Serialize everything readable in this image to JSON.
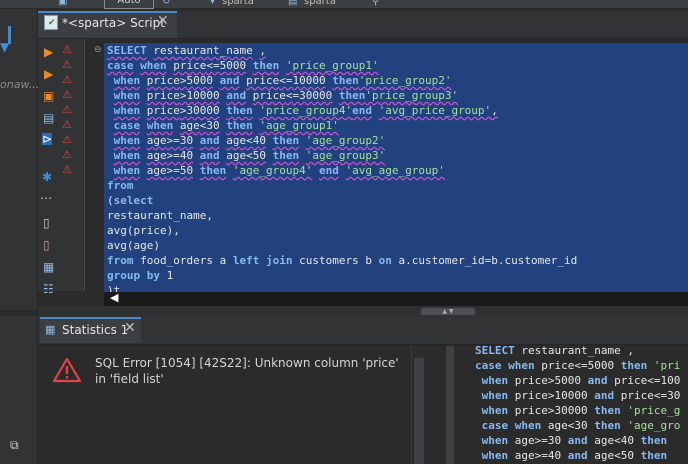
{
  "toolbar": {
    "transaction_mode": "Auto",
    "datasource_1": "sparta",
    "datasource_2": "sparta"
  },
  "left_panel": {
    "partial_label": "onaw..."
  },
  "editor": {
    "tab_title": "*<sparta> Script",
    "lines": [
      "SELECT restaurant_name ,",
      "case when price<=5000 then 'price_group1'",
      " when price>5000 and price<=10000 then'price_group2'",
      " when price>10000 and price<=30000 then'price_group3'",
      " when price>30000 then 'price_group4'end 'avg_price_group',",
      " case when age<30 then 'age_group1'",
      " when age>=30 and age<40 then 'age_group2'",
      " when age>=40 and age<50 then 'age_group3'",
      " when age>=50 then 'age_group4' end 'avg_age_group'",
      "from",
      "(select",
      "restaurant_name,",
      "avg(price),",
      "avg(age)",
      "from food_orders a left join customers b on a.customer_id=b.customer_id",
      "group by 1",
      ")t"
    ],
    "warning_count": 9
  },
  "results": {
    "tab_title": "Statistics 1",
    "error_message": "SQL Error [1054] [42S22]: Unknown column 'price' in 'field list'",
    "query_lines": [
      "SELECT restaurant_name ,",
      "case when price<=5000 then 'pri",
      " when price>5000 and price<=100",
      " when price>10000 and price<=30",
      " when price>30000 then 'price_g",
      " case when age<30 then 'age_gro",
      " when age>=30 and age<40 then",
      " when age>=40 and age<50 then"
    ]
  },
  "colors": {
    "selection": "#21427f",
    "keyword": "#86b8f2",
    "string": "#a5e09c",
    "error": "#e04545",
    "active_tab_accent": "#4a88c7"
  },
  "icons": {
    "left_filter": "filter-icon",
    "tab_script": "sql-script-icon",
    "tab_stats": "grid-icon",
    "error": "error-triangle-icon"
  }
}
